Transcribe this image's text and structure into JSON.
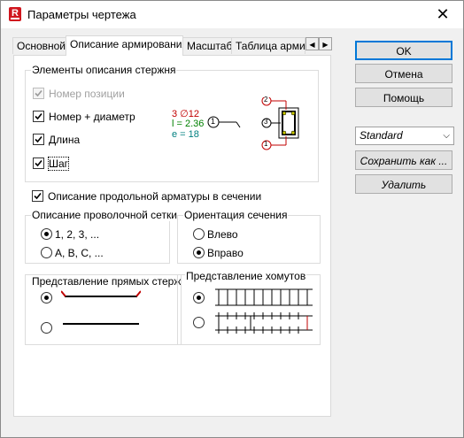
{
  "window": {
    "title": "Параметры чертежа",
    "icon_letter": "R",
    "close_glyph": "✕"
  },
  "tabs": [
    "Основной",
    "Описание армирования",
    "Масштаб",
    "Таблица армир"
  ],
  "tab_scroll": {
    "left": "◀",
    "right": "▶"
  },
  "groups": {
    "elements": "Элементы описания стержня",
    "mesh": "Описание проволочной сетки",
    "orientation": "Ориентация сечения",
    "straight": "Представление прямых стержней",
    "stirrups": "Представление хомутов"
  },
  "element_options": [
    {
      "label": "Номер позиции",
      "checked": true,
      "disabled": true
    },
    {
      "label": "Номер + диаметр",
      "checked": true,
      "disabled": false
    },
    {
      "label": "Длина",
      "checked": true,
      "disabled": false
    },
    {
      "label": "Шаг",
      "checked": true,
      "disabled": false
    }
  ],
  "preview": {
    "diameter": "3 ∅12",
    "length": "l = 2.36",
    "spacing": "e = 18",
    "marker_main": "1",
    "marker_top": "2",
    "marker_mid": "3",
    "marker_bottom": "1",
    "colors": {
      "red": "#c00000",
      "green": "#008000",
      "teal": "#008080"
    }
  },
  "longitudinal": {
    "label": "Описание продольной арматуры в сечении",
    "checked": true
  },
  "mesh_options": [
    {
      "label": "1, 2, 3, ...",
      "selected": true
    },
    {
      "label": "A, B, C, ...",
      "selected": false
    }
  ],
  "orientation_options": [
    {
      "label": "Влево",
      "selected": false
    },
    {
      "label": "Вправо",
      "selected": true
    }
  ],
  "buttons": {
    "ok": "OK",
    "cancel": "Отмена",
    "help": "Помощь",
    "save_as": "Сохранить как ...",
    "delete": "Удалить"
  },
  "style_combo": {
    "value": "Standard",
    "arrow": "⌵"
  }
}
